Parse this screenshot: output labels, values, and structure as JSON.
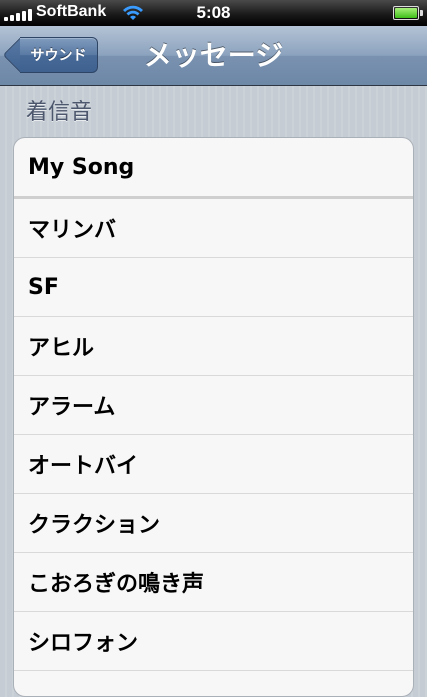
{
  "status_bar": {
    "carrier": "SoftBank",
    "time": "5:08",
    "signal_bars": 5,
    "wifi_icon": "wifi-icon",
    "battery_level": 1.0
  },
  "nav_bar": {
    "back_label": "サウンド",
    "title": "メッセージ"
  },
  "section": {
    "header": "着信音"
  },
  "list": {
    "items": [
      {
        "label": "My Song"
      },
      {
        "label": "マリンバ"
      },
      {
        "label": "SF"
      },
      {
        "label": "アヒル"
      },
      {
        "label": "アラーム"
      },
      {
        "label": "オートバイ"
      },
      {
        "label": "クラクション"
      },
      {
        "label": "こおろぎの鳴き声"
      },
      {
        "label": "シロフォン"
      }
    ]
  },
  "colors": {
    "nav_bar": "#8ba2be",
    "background": "#c5ccd4",
    "section_header": "#4c566c"
  }
}
